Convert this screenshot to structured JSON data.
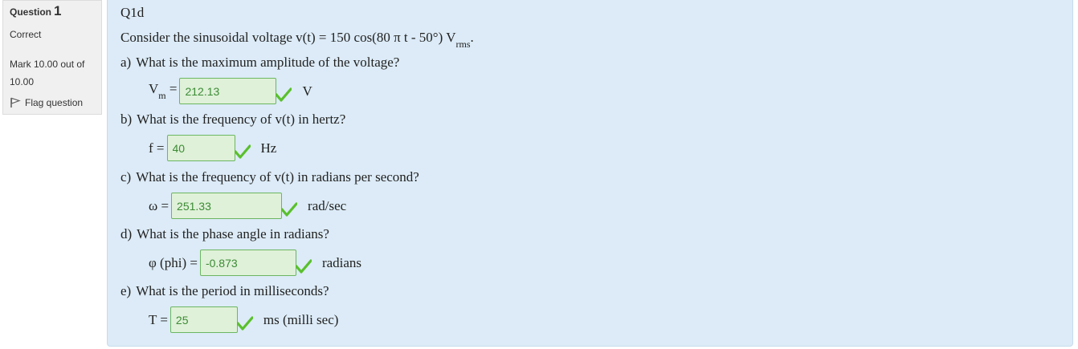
{
  "info": {
    "question_label": "Question",
    "question_number": "1",
    "state": "Correct",
    "grade": "Mark 10.00 out of 10.00",
    "flag_label": "Flag question",
    "flag_icon": "flag-icon"
  },
  "question": {
    "title": "Q1d",
    "prompt_main": "Consider the sinusoidal voltage v(t) = 150 cos(80 π t - 50°) V",
    "prompt_sub": "rms",
    "prompt_end": ".",
    "parts": [
      {
        "letter": "a)",
        "text": "What is the maximum amplitude of the voltage?",
        "label": "V",
        "label_sub": "m",
        "label_eq": " =",
        "value": "212.13",
        "unit": "V"
      },
      {
        "letter": "b)",
        "text": "What is the frequency of v(t) in hertz?",
        "label": "f =",
        "value": "40",
        "unit": "Hz"
      },
      {
        "letter": "c)",
        "text": "What is the frequency of v(t) in radians per second?",
        "label": "ω =",
        "value": "251.33",
        "unit": "rad/sec"
      },
      {
        "letter": "d)",
        "text": "What is the phase angle in radians?",
        "label": "φ (phi) =",
        "value": "-0.873",
        "unit": "radians"
      },
      {
        "letter": "e)",
        "text": "What is the period in milliseconds?",
        "label": "T =",
        "value": "25",
        "unit": "ms (milli sec)"
      }
    ]
  },
  "colors": {
    "panel_bg": "#dcebf7",
    "correct_field_bg": "#dff1d8",
    "correct_text": "#3c8b35",
    "tick": "#5ac02c"
  }
}
